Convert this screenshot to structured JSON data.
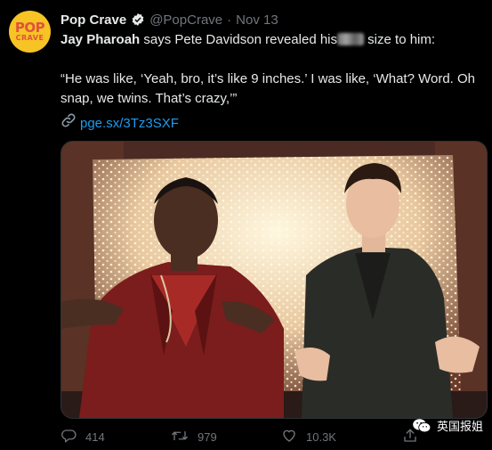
{
  "tweet": {
    "author_name": "Pop Crave",
    "handle": "@PopCrave",
    "separator": "·",
    "date": "Nov 13",
    "text_bold": "Jay Pharoah",
    "text_pre_blur": " says Pete Davidson revealed his",
    "text_post_blur": " size to him:",
    "quote": "“He was like, ‘Yeah, bro, it’s like 9 inches.’ I was like, ‘What? Word. Oh snap, we twins. That’s crazy,’”",
    "link": "pge.sx/3Tz3SXF"
  },
  "avatar": {
    "line1": "POP",
    "line2": "CRAVE"
  },
  "actions": {
    "replies": "414",
    "retweets": "979",
    "likes": "10.3K"
  },
  "watermark": "英国报姐",
  "icons": {
    "verified": "verified-badge-icon",
    "link": "link-chain-icon",
    "reply": "reply-icon",
    "retweet": "retweet-icon",
    "like": "heart-icon",
    "share": "share-icon",
    "watermark": "wechat-icon"
  },
  "colors": {
    "accent": "#1d9bf0",
    "muted": "#71767b",
    "background": "#000000",
    "avatar": "#f7c325"
  }
}
